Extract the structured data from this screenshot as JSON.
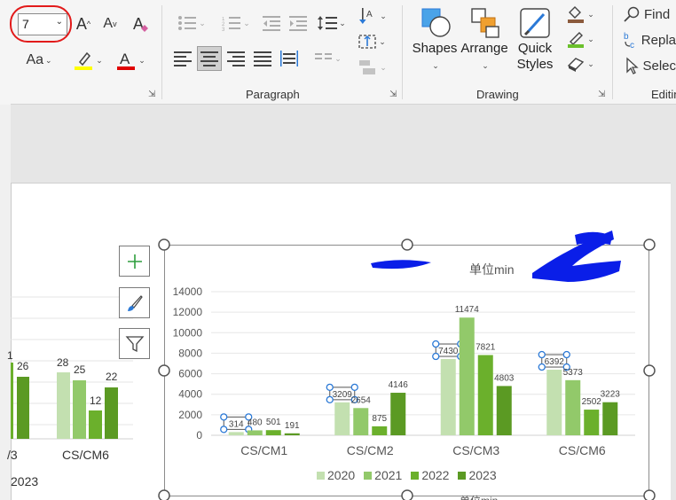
{
  "ribbon": {
    "font_size_value": "7",
    "groups": [
      {
        "label": "Paragraph"
      },
      {
        "label": "Drawing"
      },
      {
        "label": "Editin"
      }
    ],
    "drawing": {
      "shapes_label": "Shapes",
      "arrange_label": "Arrange",
      "quick_styles_label": "Quick Styles"
    },
    "editing": {
      "find_label": "Find",
      "replace_label": "Repla",
      "select_label": "Selec"
    },
    "font_group": {
      "aa_label": "Aa",
      "grow_label": "A",
      "shrink_label": "A",
      "clear_label": "A"
    },
    "colors": {
      "highlight": "#ffff00",
      "font_color": "#e00000",
      "accent": "#2b79d6"
    }
  },
  "left_chart": {
    "labels_top": [
      "1",
      "26",
      "28",
      "25",
      "12",
      "22"
    ],
    "category_labels": [
      "/3",
      "CS/CM6"
    ],
    "legend_fragment": "2023"
  },
  "chart_data": {
    "type": "bar",
    "title": "单位min",
    "categories": [
      "CS/CM1",
      "CS/CM2",
      "CS/CM3",
      "CS/CM6"
    ],
    "series": [
      {
        "name": "2020",
        "color": "#c3e0b0",
        "values": [
          314,
          3209,
          7430,
          6392
        ]
      },
      {
        "name": "2021",
        "color": "#92c96a",
        "values": [
          480,
          2654,
          11474,
          5373
        ]
      },
      {
        "name": "2022",
        "color": "#6bb02c",
        "values": [
          501,
          875,
          7821,
          2502
        ]
      },
      {
        "name": "2023",
        "color": "#5b9a23",
        "values": [
          191,
          4146,
          4803,
          3223
        ]
      }
    ],
    "data_labels": [
      [
        "314",
        "480",
        "501",
        "191"
      ],
      [
        "3209",
        "2654",
        "875",
        "4146"
      ],
      [
        "7430",
        "11474",
        "7821",
        "4803"
      ],
      [
        "6392",
        "5373",
        "2502",
        "3223"
      ]
    ],
    "yticks": [
      "0",
      "2000",
      "4000",
      "6000",
      "8000",
      "10000",
      "12000",
      "14000"
    ],
    "ylim": [
      0,
      14000
    ],
    "legend_position": "bottom",
    "grid": true,
    "bottom_caption": "单位min"
  }
}
